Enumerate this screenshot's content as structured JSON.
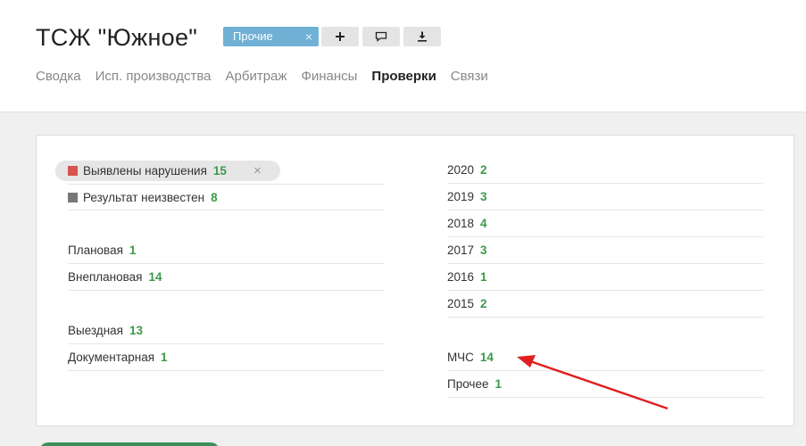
{
  "header": {
    "title": "ТСЖ \"Южное\"",
    "tag": {
      "label": "Прочие",
      "close": "×"
    }
  },
  "tabs": [
    {
      "label": "Сводка"
    },
    {
      "label": "Исп. производства"
    },
    {
      "label": "Арбитраж"
    },
    {
      "label": "Финансы"
    },
    {
      "label": "Проверки",
      "active": true
    },
    {
      "label": "Связи"
    }
  ],
  "filters": {
    "left": {
      "result": [
        {
          "label": "Выявлены нарушения",
          "count": "15",
          "color": "#d9534f",
          "selected": true,
          "close": "×"
        },
        {
          "label": "Результат неизвестен",
          "count": "8",
          "color": "#777777"
        }
      ],
      "kind": [
        {
          "label": "Плановая",
          "count": "1"
        },
        {
          "label": "Внеплановая",
          "count": "14"
        }
      ],
      "form": [
        {
          "label": "Выездная",
          "count": "13"
        },
        {
          "label": "Документарная",
          "count": "1"
        }
      ]
    },
    "right": {
      "years": [
        {
          "label": "2020",
          "count": "2"
        },
        {
          "label": "2019",
          "count": "3"
        },
        {
          "label": "2018",
          "count": "4"
        },
        {
          "label": "2017",
          "count": "3"
        },
        {
          "label": "2016",
          "count": "1"
        },
        {
          "label": "2015",
          "count": "2"
        }
      ],
      "agency": [
        {
          "label": "МЧС",
          "count": "14"
        },
        {
          "label": "Прочее",
          "count": "1"
        }
      ]
    }
  },
  "colors": {
    "accent_count": "#3b9a4a",
    "tag_bg": "#6fb0d4",
    "arrow": "#e02020"
  },
  "icons": [
    "plus-icon",
    "comment-icon",
    "download-icon",
    "close-icon",
    "arrow-annotation"
  ]
}
